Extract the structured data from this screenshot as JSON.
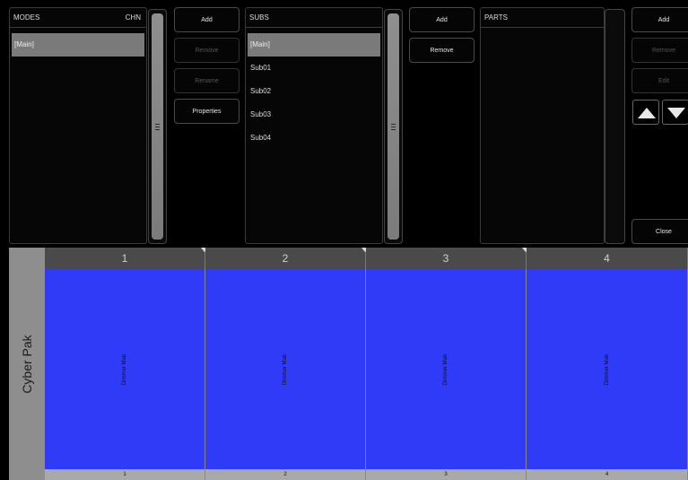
{
  "modes": {
    "title": "MODES",
    "right_label": "CHN",
    "items": [
      "[Main]"
    ],
    "buttons": {
      "add": "Add",
      "remove": "Remove",
      "rename": "Rename",
      "properties": "Properties"
    }
  },
  "subs": {
    "title": "SUBS",
    "items": [
      "[Main]",
      "Sub01",
      "Sub02",
      "Sub03",
      "Sub04"
    ],
    "buttons": {
      "add": "Add",
      "remove": "Remove"
    }
  },
  "parts": {
    "title": "PARTS",
    "buttons": {
      "add": "Add",
      "remove": "Remove",
      "edit": "Edit",
      "close": "Close"
    }
  },
  "grid": {
    "row_label": "Cyber Pak",
    "columns": [
      {
        "header": "1",
        "cell": "Dimmer Mab",
        "footer": "1"
      },
      {
        "header": "2",
        "cell": "Dimmer Mab",
        "footer": "2"
      },
      {
        "header": "3",
        "cell": "Dimmer Mab",
        "footer": "3"
      },
      {
        "header": "4",
        "cell": "Dimmer Mab",
        "footer": "4"
      }
    ]
  },
  "colors": {
    "cell_fill": "#2f3bf6",
    "selected_row": "#7a7a7a",
    "panel_background": "#060606"
  },
  "icons": {
    "scroll_grip": "grip-lines-icon",
    "move_up": "arrow-up-icon",
    "move_down": "arrow-down-icon"
  }
}
